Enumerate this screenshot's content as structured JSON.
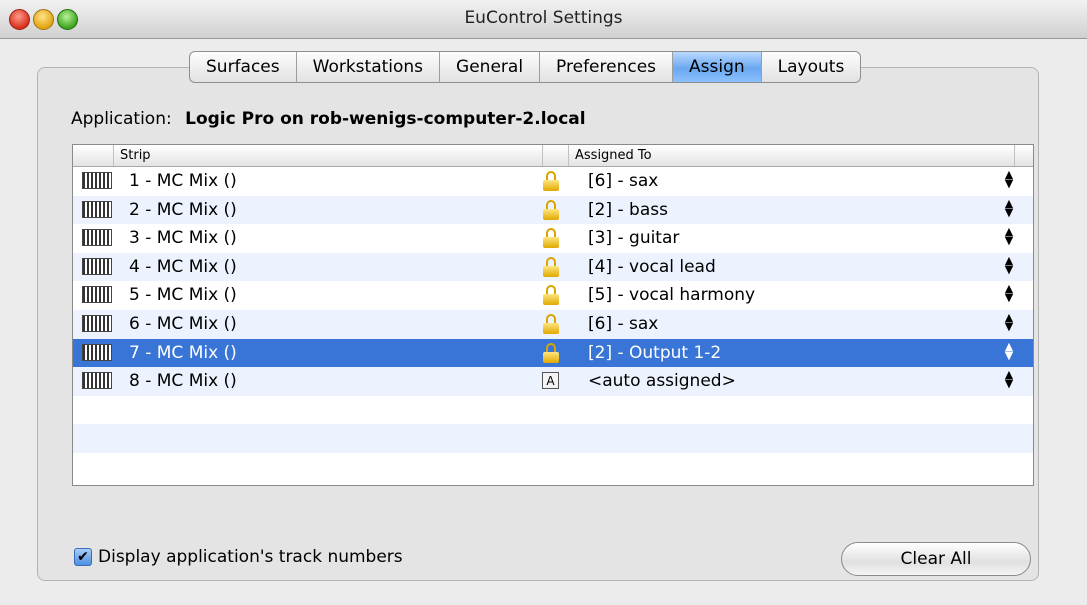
{
  "window": {
    "title": "EuControl Settings"
  },
  "tabs": [
    {
      "label": "Surfaces",
      "active": false
    },
    {
      "label": "Workstations",
      "active": false
    },
    {
      "label": "General",
      "active": false
    },
    {
      "label": "Preferences",
      "active": false
    },
    {
      "label": "Assign",
      "active": true
    },
    {
      "label": "Layouts",
      "active": false
    }
  ],
  "application": {
    "label": "Application:",
    "value": "Logic Pro on rob-wenigs-computer-2.local"
  },
  "table": {
    "columns": [
      "Strip",
      "Assigned To"
    ],
    "rows": [
      {
        "strip": "1 - MC Mix ()",
        "status": "locked",
        "assigned": "[6] - sax",
        "selected": false
      },
      {
        "strip": "2 - MC Mix ()",
        "status": "locked",
        "assigned": "[2] - bass",
        "selected": false
      },
      {
        "strip": "3 - MC Mix ()",
        "status": "locked",
        "assigned": "[3] - guitar",
        "selected": false
      },
      {
        "strip": "4 - MC Mix ()",
        "status": "locked",
        "assigned": "[4] - vocal lead",
        "selected": false
      },
      {
        "strip": "5 - MC Mix ()",
        "status": "locked",
        "assigned": "[5] - vocal harmony",
        "selected": false
      },
      {
        "strip": "6 - MC Mix ()",
        "status": "locked",
        "assigned": "[6] - sax",
        "selected": false
      },
      {
        "strip": "7 - MC Mix ()",
        "status": "locked",
        "assigned": "[2] - Output 1-2",
        "selected": true
      },
      {
        "strip": "8 - MC Mix ()",
        "status": "auto",
        "auto_glyph": "A",
        "assigned": "<auto assigned>",
        "selected": false
      }
    ],
    "updown_glyph": "▲▼"
  },
  "options": {
    "display_track_numbers": {
      "label": "Display application's track numbers",
      "checked": true
    }
  },
  "buttons": {
    "clear_all": "Clear All"
  },
  "colors": {
    "selection": "#3875d7",
    "active_tab": "#6aa8f0",
    "lock": "#e0a800"
  }
}
